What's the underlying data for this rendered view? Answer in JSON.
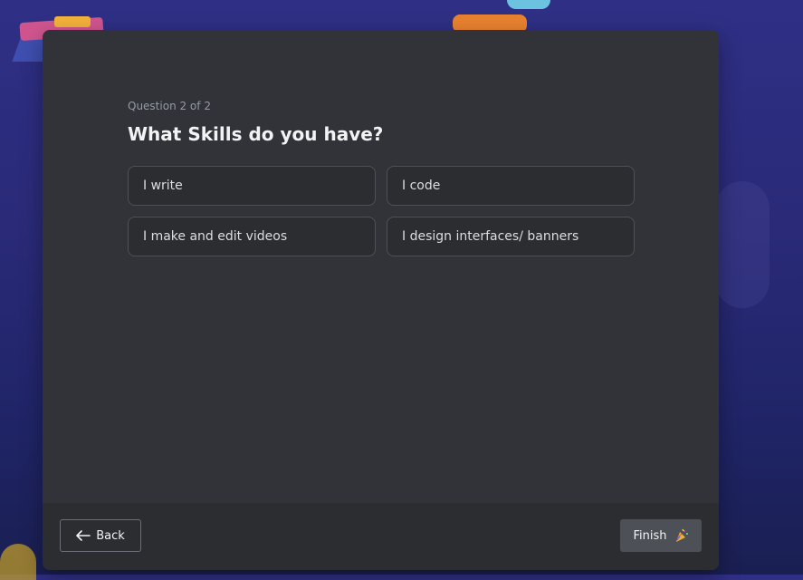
{
  "onboarding": {
    "progress_label": "Question 2 of 2",
    "question": "What Skills do you have?",
    "options": [
      {
        "label": "I write"
      },
      {
        "label": "I code"
      },
      {
        "label": "I make and edit videos"
      },
      {
        "label": "I design interfaces/ banners"
      }
    ]
  },
  "footer": {
    "back_label": "Back",
    "back_icon": "arrow-left-icon",
    "finish_label": "Finish",
    "finish_icon": "party-popper-icon"
  },
  "colors": {
    "modal_bg": "#313338",
    "footer_bg": "#2b2d31",
    "option_border": "#4e5058",
    "finish_bg": "#4e5058",
    "page_bg": "#2a2a78"
  }
}
